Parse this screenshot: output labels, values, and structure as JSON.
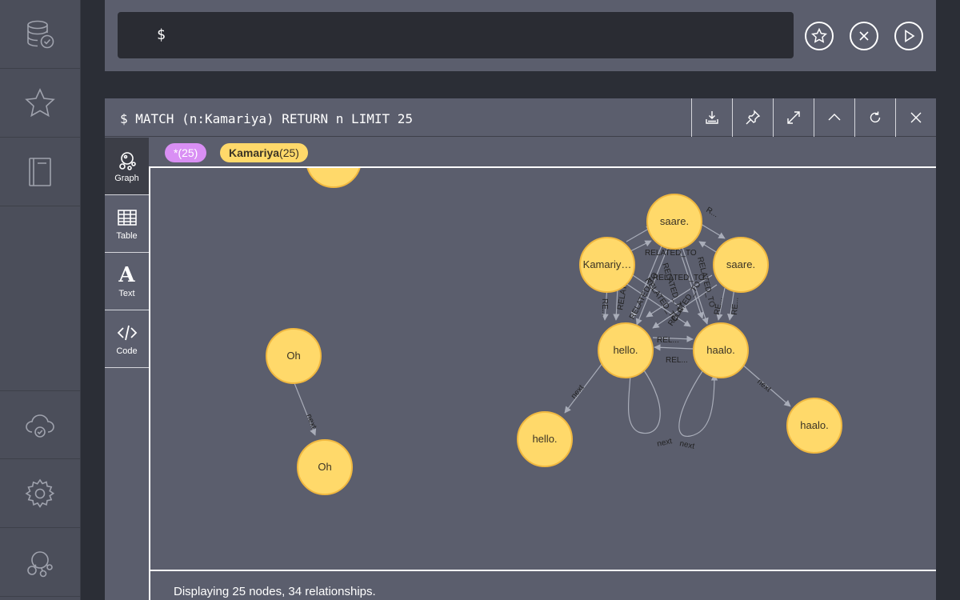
{
  "editor": {
    "prompt": "$"
  },
  "frame": {
    "query": "$ MATCH (n:Kamariya) RETURN n LIMIT 25",
    "status": "Displaying 25 nodes, 34 relationships."
  },
  "tabs": [
    {
      "label": "Graph",
      "icon": "graph-icon"
    },
    {
      "label": "Table",
      "icon": "table-icon"
    },
    {
      "label": "Text",
      "icon": "text-icon",
      "glyph": "A"
    },
    {
      "label": "Code",
      "icon": "code-icon"
    }
  ],
  "legend": {
    "all": "*(25)",
    "label_name": "Kamariya",
    "label_count": "(25)"
  },
  "graph": {
    "nodes": [
      {
        "id": "top",
        "label": ""
      },
      {
        "id": "oh1",
        "label": "Oh"
      },
      {
        "id": "oh2",
        "label": "Oh"
      },
      {
        "id": "saareTop",
        "label": "saare."
      },
      {
        "id": "kam",
        "label": "Kamariy…"
      },
      {
        "id": "saareRight",
        "label": "saare."
      },
      {
        "id": "hello1",
        "label": "hello."
      },
      {
        "id": "haalo1",
        "label": "haalo."
      },
      {
        "id": "hello2",
        "label": "hello."
      },
      {
        "id": "haalo2",
        "label": "haalo."
      }
    ],
    "rel_labels": {
      "related": "RELATED_TO",
      "related_short1": "RELATED_TO",
      "related_short2": "R...",
      "re": "RE...",
      "rel": "REL...",
      "next": "next"
    }
  },
  "colors": {
    "node_fill": "#ffd96a",
    "node_stroke": "#f0b840",
    "pill_all": "#d98ff4",
    "edge": "#a9adb9"
  }
}
